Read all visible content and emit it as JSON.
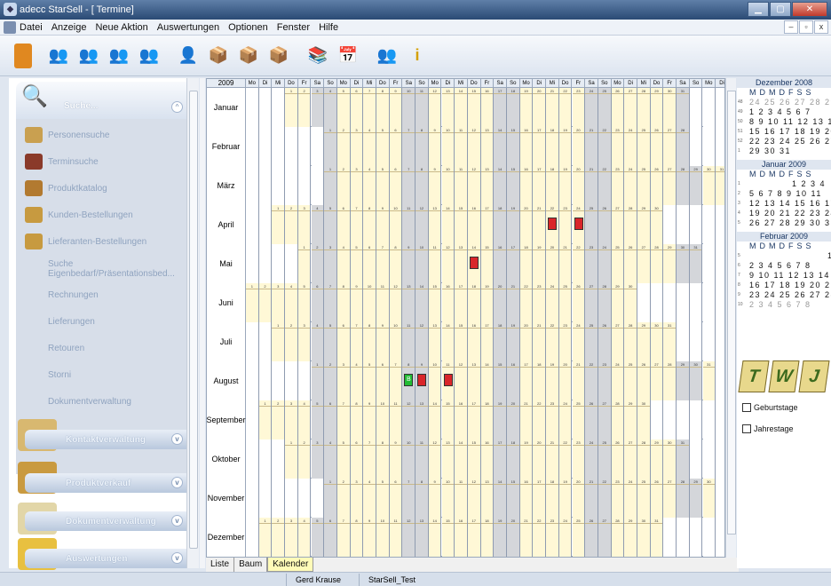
{
  "window": {
    "title": "adecc StarSell - [ Termine]"
  },
  "menu": {
    "items": [
      "Datei",
      "Anzeige",
      "Neue Aktion",
      "Auswertungen",
      "Optionen",
      "Fenster",
      "Hilfe"
    ]
  },
  "sidebar": {
    "search_label": "Suche...",
    "items": [
      {
        "label": "Personensuche",
        "icon": "person-search-icon"
      },
      {
        "label": "Terminsuche",
        "icon": "calendar-search-icon"
      },
      {
        "label": "Produktkatalog",
        "icon": "catalog-icon"
      },
      {
        "label": "Kunden-Bestellungen",
        "icon": "customer-order-icon"
      },
      {
        "label": "Lieferanten-Bestellungen",
        "icon": "supplier-order-icon"
      },
      {
        "label": "Suche Eigenbedarf/Präsentationsbed..."
      },
      {
        "label": "Rechnungen"
      },
      {
        "label": "Lieferungen"
      },
      {
        "label": "Retouren"
      },
      {
        "label": "Storni"
      },
      {
        "label": "Dokumentverwaltung"
      }
    ],
    "sections": [
      "Kontaktverwaltung",
      "Produktverkauf",
      "Dokumentverwaltung",
      "Auswertungen"
    ]
  },
  "calendar": {
    "year": "2009",
    "day_headers": [
      "Mo",
      "Di",
      "Mi",
      "Do",
      "Fr",
      "Sa",
      "So",
      "Mo",
      "Di",
      "Mi",
      "Do",
      "Fr",
      "Sa",
      "So",
      "Mo",
      "Di",
      "Mi",
      "Do",
      "Fr",
      "Sa",
      "So",
      "Mo",
      "Di",
      "Mi",
      "Do",
      "Fr",
      "Sa",
      "So",
      "Mo",
      "Di",
      "Mi",
      "Do",
      "Fr",
      "Sa",
      "So",
      "Mo",
      "Di"
    ],
    "months": [
      {
        "name": "Januar",
        "start": 3,
        "days": 31
      },
      {
        "name": "Februar",
        "start": 6,
        "days": 28
      },
      {
        "name": "März",
        "start": 6,
        "days": 31
      },
      {
        "name": "April",
        "start": 2,
        "days": 30
      },
      {
        "name": "Mai",
        "start": 4,
        "days": 31
      },
      {
        "name": "Juni",
        "start": 0,
        "days": 30
      },
      {
        "name": "Juli",
        "start": 2,
        "days": 31
      },
      {
        "name": "August",
        "start": 5,
        "days": 31
      },
      {
        "name": "September",
        "start": 1,
        "days": 30
      },
      {
        "name": "Oktober",
        "start": 3,
        "days": 31
      },
      {
        "name": "November",
        "start": 6,
        "days": 30
      },
      {
        "name": "Dezember",
        "start": 1,
        "days": 31
      }
    ],
    "events": [
      {
        "month": 3,
        "day": 22,
        "color": "#d9262a",
        "label": ""
      },
      {
        "month": 3,
        "day": 24,
        "color": "#d9262a",
        "label": ""
      },
      {
        "month": 4,
        "day": 14,
        "color": "#d9262a",
        "label": ""
      },
      {
        "month": 7,
        "day": 8,
        "color": "#22bb33",
        "label": "B"
      },
      {
        "month": 7,
        "day": 9,
        "color": "#d9262a",
        "label": ""
      },
      {
        "month": 7,
        "day": 11,
        "color": "#d9262a",
        "label": ""
      }
    ]
  },
  "tabs": [
    "Liste",
    "Baum",
    "Kalender"
  ],
  "mini_calendars": [
    {
      "title": "Dezember 2008",
      "rows": [
        {
          "wk": "48",
          "days": "24 25 26 27 28 29 30",
          "grey": true
        },
        {
          "wk": "49",
          "days": "1 2 3 4 5 6 7"
        },
        {
          "wk": "50",
          "days": "8 9 10 11 12 13 14"
        },
        {
          "wk": "51",
          "days": "15 16 17 18 19 20 21"
        },
        {
          "wk": "52",
          "days": "22 23 24 25 26 27 28"
        },
        {
          "wk": "1",
          "days": "29 30 31"
        }
      ]
    },
    {
      "title": "Januar 2009",
      "rows": [
        {
          "wk": "1",
          "days": "            1 2 3 4"
        },
        {
          "wk": "2",
          "days": "5 6 7 8 9 10 11"
        },
        {
          "wk": "3",
          "days": "12 13 14 15 16 17 18"
        },
        {
          "wk": "4",
          "days": "19 20 21 22 23 24 25"
        },
        {
          "wk": "5",
          "days": "26 27 28 29 30 31"
        }
      ]
    },
    {
      "title": "Februar 2009",
      "rows": [
        {
          "wk": "5",
          "days": "                      1"
        },
        {
          "wk": "6",
          "days": "2 3 4 5 6 7 8"
        },
        {
          "wk": "7",
          "days": "9 10 11 12 13 14 15"
        },
        {
          "wk": "8",
          "days": "16 17 18 19 20 21 22"
        },
        {
          "wk": "9",
          "days": "23 24 25 26 27 28 1"
        },
        {
          "wk": "10",
          "days": "2 3 4 5 6 7 8",
          "grey": true
        }
      ]
    }
  ],
  "mini_dow": "MDMDFSS",
  "checks": {
    "geburtstage": "Geburtstage",
    "jahrestage": "Jahrestage"
  },
  "status": {
    "user": "Gerd Krause",
    "db": "StarSell_Test"
  }
}
